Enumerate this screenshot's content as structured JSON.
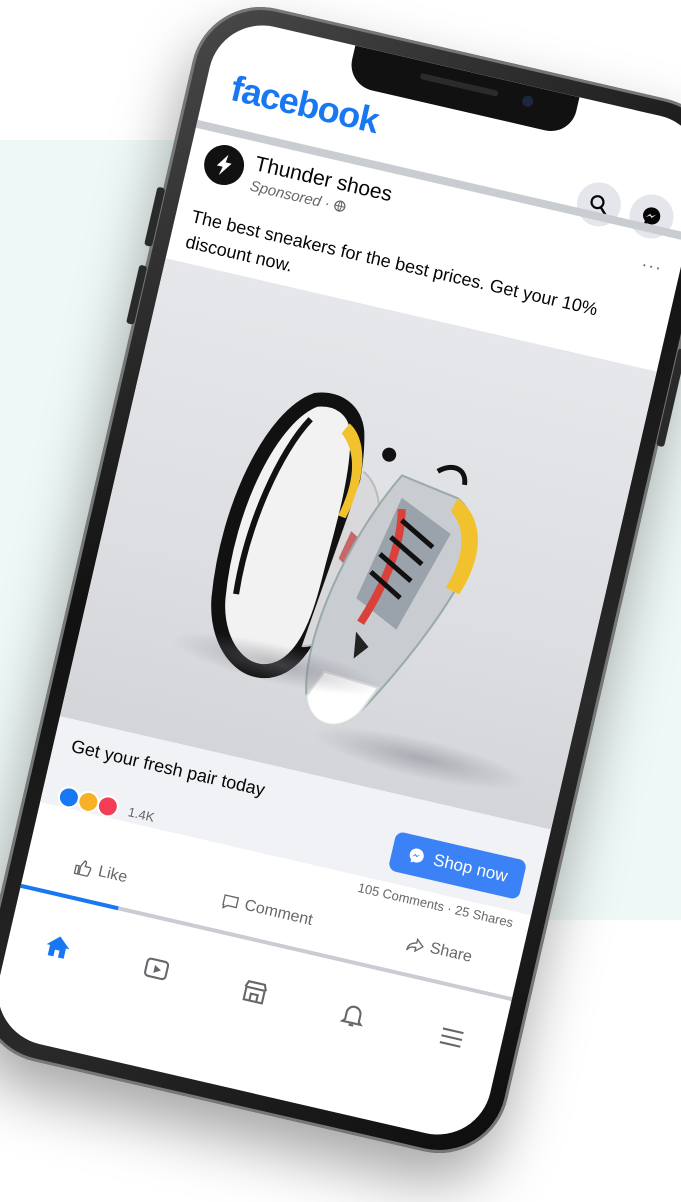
{
  "app": {
    "logo_text": "facebook",
    "brand_color": "#1877f2"
  },
  "topbar": {
    "search_icon": "search-icon",
    "messenger_icon": "messenger-icon"
  },
  "post": {
    "page_name": "Thunder shoes",
    "sponsored_label": "Sponsored · ",
    "privacy_icon": "globe-icon",
    "more_label": "···",
    "caption": "The best sneakers for the best prices. Get your 10% discount now.",
    "media_description_icon": "sneakers-image",
    "link_headline": "Get your fresh pair today",
    "cta_label": "Shop now",
    "cta_icon": "messenger-icon",
    "reaction_count": "1.4K",
    "reactions": [
      "like",
      "wow",
      "love"
    ],
    "comments_shares": "105 Comments · 25 Shares",
    "actions": [
      {
        "label": "Like",
        "icon": "thumbs-up-icon"
      },
      {
        "label": "Comment",
        "icon": "comment-icon"
      },
      {
        "label": "Share",
        "icon": "share-icon"
      }
    ]
  },
  "bottom_nav": {
    "items": [
      {
        "name": "home",
        "icon": "home-icon",
        "active": true
      },
      {
        "name": "watch",
        "icon": "video-icon",
        "active": false
      },
      {
        "name": "marketplace",
        "icon": "store-icon",
        "active": false
      },
      {
        "name": "notifications",
        "icon": "bell-icon",
        "active": false
      },
      {
        "name": "menu",
        "icon": "menu-icon",
        "active": false
      }
    ]
  }
}
